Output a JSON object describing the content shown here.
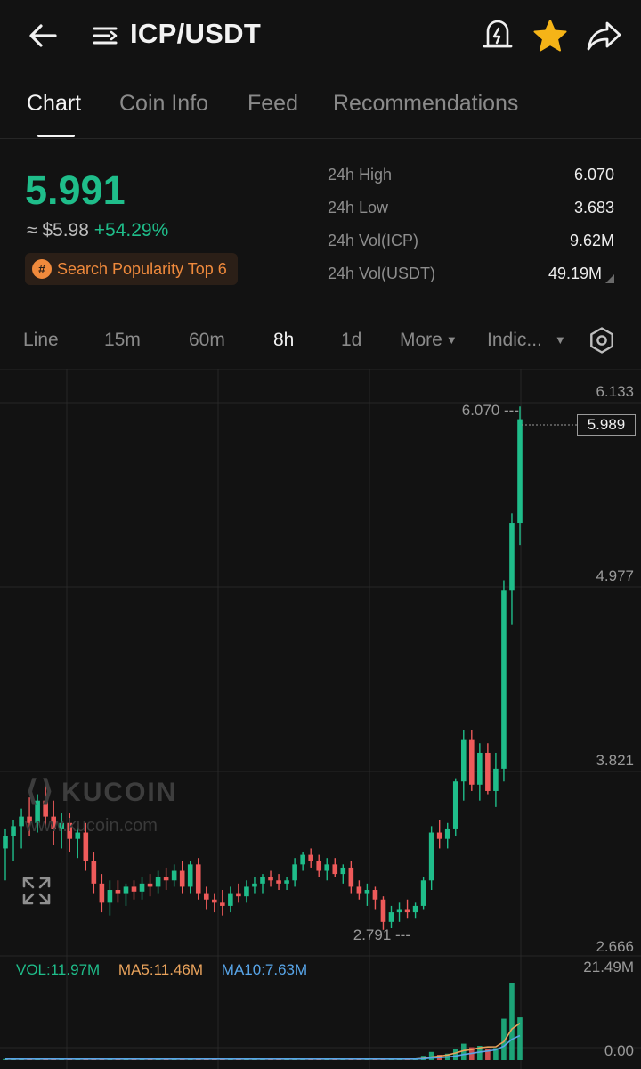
{
  "header": {
    "pair": "ICP/USDT",
    "icons": [
      "back-arrow-icon",
      "menu-icon",
      "price-alert-icon",
      "star-icon",
      "share-icon"
    ],
    "star_color": "#f5b417"
  },
  "tabs": [
    {
      "label": "Chart",
      "active": true
    },
    {
      "label": "Coin Info",
      "active": false
    },
    {
      "label": "Feed",
      "active": false
    },
    {
      "label": "Recommendations",
      "active": false
    }
  ],
  "ticker": {
    "price": "5.991",
    "usd_value": "≈ $5.98",
    "change": "+54.29%",
    "badge_icon": "#",
    "badge_text": "Search Popularity Top 6",
    "up_color": "#1fbd8a"
  },
  "stats": [
    {
      "label": "24h High",
      "value": "6.070"
    },
    {
      "label": "24h Low",
      "value": "3.683"
    },
    {
      "label": "24h Vol(ICP)",
      "value": "9.62M"
    },
    {
      "label": "24h Vol(USDT)",
      "value": "49.19M"
    }
  ],
  "intervals": [
    {
      "label": "Line",
      "active": false
    },
    {
      "label": "15m",
      "active": false
    },
    {
      "label": "60m",
      "active": false
    },
    {
      "label": "8h",
      "active": true
    },
    {
      "label": "1d",
      "active": false
    },
    {
      "label": "More",
      "active": false,
      "dropdown": true
    },
    {
      "label": "Indic...",
      "active": false,
      "dropdown": true
    }
  ],
  "chart": {
    "watermark_logo": "KUCOIN",
    "watermark_url": "www.kucoin.com",
    "current_price_tag": "5.989",
    "high_marker": "6.070 ---",
    "low_marker": "2.791 ---",
    "volume": {
      "vol": "VOL:11.97M",
      "ma5": "MA5:11.46M",
      "ma10": "MA10:7.63M"
    },
    "volume_axis": [
      "21.49M",
      "0.00"
    ]
  },
  "chart_data": {
    "type": "candlestick",
    "y_axis_ticks": [
      "6.133",
      "4.977",
      "3.821",
      "2.666"
    ],
    "ylim": [
      2.666,
      6.133
    ],
    "high": 6.07,
    "low": 2.791,
    "last": 5.989,
    "colors": {
      "up": "#1fbd8a",
      "down": "#ee5a5a",
      "ma5": "#e9a35c",
      "ma10": "#58a5e8"
    },
    "candles": [
      {
        "o": 3.3,
        "h": 3.42,
        "l": 3.1,
        "c": 3.38
      },
      {
        "o": 3.38,
        "h": 3.48,
        "l": 3.22,
        "c": 3.44
      },
      {
        "o": 3.44,
        "h": 3.55,
        "l": 3.3,
        "c": 3.5
      },
      {
        "o": 3.5,
        "h": 3.62,
        "l": 3.38,
        "c": 3.46
      },
      {
        "o": 3.46,
        "h": 3.64,
        "l": 3.4,
        "c": 3.6
      },
      {
        "o": 3.6,
        "h": 3.7,
        "l": 3.44,
        "c": 3.5
      },
      {
        "o": 3.5,
        "h": 3.6,
        "l": 3.32,
        "c": 3.42
      },
      {
        "o": 3.42,
        "h": 3.52,
        "l": 3.3,
        "c": 3.46
      },
      {
        "o": 3.46,
        "h": 3.52,
        "l": 3.28,
        "c": 3.36
      },
      {
        "o": 3.36,
        "h": 3.44,
        "l": 3.24,
        "c": 3.4
      },
      {
        "o": 3.4,
        "h": 3.46,
        "l": 3.16,
        "c": 3.22
      },
      {
        "o": 3.22,
        "h": 3.28,
        "l": 3.02,
        "c": 3.08
      },
      {
        "o": 3.08,
        "h": 3.14,
        "l": 2.9,
        "c": 2.96
      },
      {
        "o": 2.96,
        "h": 3.1,
        "l": 2.88,
        "c": 3.04
      },
      {
        "o": 3.04,
        "h": 3.1,
        "l": 2.96,
        "c": 3.02
      },
      {
        "o": 3.02,
        "h": 3.08,
        "l": 2.94,
        "c": 3.06
      },
      {
        "o": 3.06,
        "h": 3.1,
        "l": 2.98,
        "c": 3.03
      },
      {
        "o": 3.03,
        "h": 3.12,
        "l": 2.98,
        "c": 3.08
      },
      {
        "o": 3.08,
        "h": 3.14,
        "l": 3.0,
        "c": 3.06
      },
      {
        "o": 3.06,
        "h": 3.16,
        "l": 3.02,
        "c": 3.12
      },
      {
        "o": 3.12,
        "h": 3.18,
        "l": 3.04,
        "c": 3.1
      },
      {
        "o": 3.1,
        "h": 3.2,
        "l": 3.06,
        "c": 3.16
      },
      {
        "o": 3.16,
        "h": 3.22,
        "l": 3.02,
        "c": 3.06
      },
      {
        "o": 3.06,
        "h": 3.22,
        "l": 3.02,
        "c": 3.2
      },
      {
        "o": 3.2,
        "h": 3.24,
        "l": 2.98,
        "c": 3.02
      },
      {
        "o": 3.02,
        "h": 3.06,
        "l": 2.92,
        "c": 2.98
      },
      {
        "o": 2.98,
        "h": 3.02,
        "l": 2.9,
        "c": 2.96
      },
      {
        "o": 2.96,
        "h": 3.04,
        "l": 2.88,
        "c": 2.94
      },
      {
        "o": 2.94,
        "h": 3.06,
        "l": 2.9,
        "c": 3.02
      },
      {
        "o": 3.02,
        "h": 3.08,
        "l": 2.96,
        "c": 3.0
      },
      {
        "o": 3.0,
        "h": 3.1,
        "l": 2.96,
        "c": 3.06
      },
      {
        "o": 3.06,
        "h": 3.12,
        "l": 3.02,
        "c": 3.08
      },
      {
        "o": 3.08,
        "h": 3.14,
        "l": 3.02,
        "c": 3.12
      },
      {
        "o": 3.12,
        "h": 3.16,
        "l": 3.06,
        "c": 3.1
      },
      {
        "o": 3.1,
        "h": 3.14,
        "l": 3.04,
        "c": 3.08
      },
      {
        "o": 3.08,
        "h": 3.12,
        "l": 3.04,
        "c": 3.1
      },
      {
        "o": 3.1,
        "h": 3.24,
        "l": 3.06,
        "c": 3.2
      },
      {
        "o": 3.2,
        "h": 3.28,
        "l": 3.16,
        "c": 3.26
      },
      {
        "o": 3.26,
        "h": 3.3,
        "l": 3.18,
        "c": 3.22
      },
      {
        "o": 3.22,
        "h": 3.26,
        "l": 3.12,
        "c": 3.16
      },
      {
        "o": 3.16,
        "h": 3.24,
        "l": 3.1,
        "c": 3.2
      },
      {
        "o": 3.2,
        "h": 3.24,
        "l": 3.12,
        "c": 3.14
      },
      {
        "o": 3.14,
        "h": 3.2,
        "l": 3.08,
        "c": 3.18
      },
      {
        "o": 3.18,
        "h": 3.22,
        "l": 3.02,
        "c": 3.06
      },
      {
        "o": 3.06,
        "h": 3.1,
        "l": 2.98,
        "c": 3.02
      },
      {
        "o": 3.02,
        "h": 3.08,
        "l": 2.94,
        "c": 3.04
      },
      {
        "o": 3.04,
        "h": 3.06,
        "l": 2.92,
        "c": 2.98
      },
      {
        "o": 2.98,
        "h": 3.0,
        "l": 2.79,
        "c": 2.84
      },
      {
        "o": 2.84,
        "h": 2.94,
        "l": 2.8,
        "c": 2.9
      },
      {
        "o": 2.9,
        "h": 2.96,
        "l": 2.84,
        "c": 2.92
      },
      {
        "o": 2.92,
        "h": 2.98,
        "l": 2.86,
        "c": 2.9
      },
      {
        "o": 2.9,
        "h": 2.96,
        "l": 2.86,
        "c": 2.94
      },
      {
        "o": 2.94,
        "h": 3.12,
        "l": 2.92,
        "c": 3.1
      },
      {
        "o": 3.1,
        "h": 3.44,
        "l": 3.04,
        "c": 3.4
      },
      {
        "o": 3.4,
        "h": 3.48,
        "l": 3.3,
        "c": 3.36
      },
      {
        "o": 3.36,
        "h": 3.46,
        "l": 3.3,
        "c": 3.42
      },
      {
        "o": 3.42,
        "h": 3.74,
        "l": 3.38,
        "c": 3.72
      },
      {
        "o": 3.72,
        "h": 4.04,
        "l": 3.6,
        "c": 3.98
      },
      {
        "o": 3.98,
        "h": 4.04,
        "l": 3.66,
        "c": 3.7
      },
      {
        "o": 3.7,
        "h": 3.96,
        "l": 3.6,
        "c": 3.9
      },
      {
        "o": 3.9,
        "h": 3.96,
        "l": 3.64,
        "c": 3.66
      },
      {
        "o": 3.66,
        "h": 3.9,
        "l": 3.56,
        "c": 3.8
      },
      {
        "o": 3.8,
        "h": 4.98,
        "l": 3.72,
        "c": 4.92
      },
      {
        "o": 4.92,
        "h": 5.4,
        "l": 4.7,
        "c": 5.34
      },
      {
        "o": 5.34,
        "h": 6.07,
        "l": 5.2,
        "c": 5.99
      }
    ],
    "volume_values": [
      0.3,
      0.3,
      0.3,
      0.3,
      0.3,
      0.3,
      0.3,
      0.3,
      0.3,
      0.3,
      0.3,
      0.3,
      0.3,
      0.3,
      0.3,
      0.3,
      0.3,
      0.3,
      0.3,
      0.3,
      0.3,
      0.3,
      0.3,
      0.3,
      0.3,
      0.3,
      0.3,
      0.3,
      0.3,
      0.3,
      0.3,
      0.3,
      0.3,
      0.3,
      0.3,
      0.3,
      0.3,
      0.3,
      0.3,
      0.3,
      0.3,
      0.3,
      0.3,
      0.3,
      0.3,
      0.3,
      0.3,
      0.3,
      0.3,
      0.3,
      0.3,
      0.3,
      1.2,
      2.3,
      1.5,
      1.8,
      3.2,
      4.6,
      3.6,
      4.0,
      3.1,
      3.4,
      11.6,
      21.49,
      11.97
    ],
    "volume_ylim": [
      0,
      21.49
    ]
  }
}
